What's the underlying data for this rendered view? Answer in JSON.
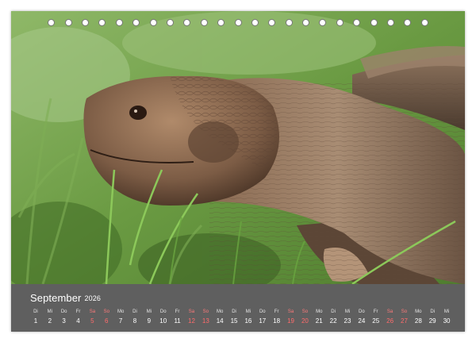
{
  "calendar": {
    "month": "September",
    "year": "2026",
    "weekdays": [
      "Di",
      "Mi",
      "Do",
      "Fr",
      "Sa",
      "So",
      "Mo",
      "Di",
      "Mi",
      "Do",
      "Fr",
      "Sa",
      "So",
      "Mo",
      "Di",
      "Mi",
      "Do",
      "Fr",
      "Sa",
      "So",
      "Mo",
      "Di",
      "Mi",
      "Do",
      "Fr",
      "Sa",
      "So",
      "Mo",
      "Di",
      "Mi"
    ],
    "days": [
      "1",
      "2",
      "3",
      "4",
      "5",
      "6",
      "7",
      "8",
      "9",
      "10",
      "11",
      "12",
      "13",
      "14",
      "15",
      "16",
      "17",
      "18",
      "19",
      "20",
      "21",
      "22",
      "23",
      "24",
      "25",
      "26",
      "27",
      "28",
      "29",
      "30"
    ],
    "weekend_color": "#ff6b6b",
    "bar_color": "#5f5f5f"
  },
  "photo": {
    "subject": "tortoise-head",
    "background_color": "#6c9a45"
  },
  "binding": {
    "ring_count": 23
  }
}
